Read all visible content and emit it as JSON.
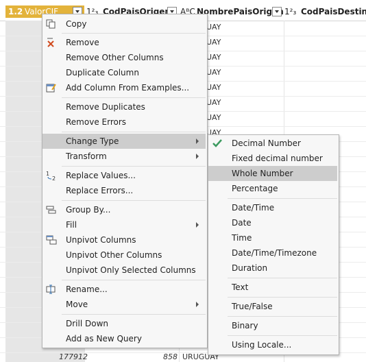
{
  "columns": {
    "c1": {
      "type_icon": "1.2",
      "name": "ValorCIF"
    },
    "c2": {
      "type_icon": "1²₃",
      "name": "CodPaisOrigen"
    },
    "c3": {
      "type_icon": "AᴮC",
      "name": "NombrePaisOrigen"
    },
    "c4": {
      "type_icon": "1²₃",
      "name": "CodPaisDestino"
    }
  },
  "visible_rows": {
    "partial_value": "UAY",
    "last_row": {
      "valor": "177912",
      "cod_origen": "858",
      "nombre_origen": "URUGUAY"
    }
  },
  "context_menu": {
    "items": [
      {
        "label": "Copy",
        "icon": "copy-icon"
      },
      {
        "label": "Remove",
        "icon": "remove-x-icon"
      },
      {
        "label": "Remove Other Columns"
      },
      {
        "label": "Duplicate Column"
      },
      {
        "label": "Add Column From Examples...",
        "icon": "add-column-examples-icon"
      },
      {
        "label": "Remove Duplicates"
      },
      {
        "label": "Remove Errors"
      },
      {
        "label": "Change Type",
        "submenu": true,
        "highlighted": true
      },
      {
        "label": "Transform",
        "submenu": true
      },
      {
        "label": "Replace Values...",
        "icon": "replace-values-icon"
      },
      {
        "label": "Replace Errors..."
      },
      {
        "label": "Group By...",
        "icon": "group-by-icon"
      },
      {
        "label": "Fill",
        "submenu": true
      },
      {
        "label": "Unpivot Columns",
        "icon": "unpivot-icon"
      },
      {
        "label": "Unpivot Other Columns"
      },
      {
        "label": "Unpivot Only Selected Columns"
      },
      {
        "label": "Rename...",
        "icon": "rename-icon"
      },
      {
        "label": "Move",
        "submenu": true
      },
      {
        "label": "Drill Down"
      },
      {
        "label": "Add as New Query"
      }
    ]
  },
  "change_type_menu": {
    "items": [
      {
        "label": "Decimal Number",
        "checked": true
      },
      {
        "label": "Fixed decimal number"
      },
      {
        "label": "Whole Number",
        "highlighted": true
      },
      {
        "label": "Percentage"
      },
      {
        "label": "Date/Time"
      },
      {
        "label": "Date"
      },
      {
        "label": "Time"
      },
      {
        "label": "Date/Time/Timezone"
      },
      {
        "label": "Duration"
      },
      {
        "label": "Text"
      },
      {
        "label": "True/False"
      },
      {
        "label": "Binary"
      },
      {
        "label": "Using Locale..."
      }
    ]
  },
  "colors": {
    "selected_header": "#e3b33b",
    "highlight": "#cdcdcd",
    "check": "#3c9a5f"
  }
}
